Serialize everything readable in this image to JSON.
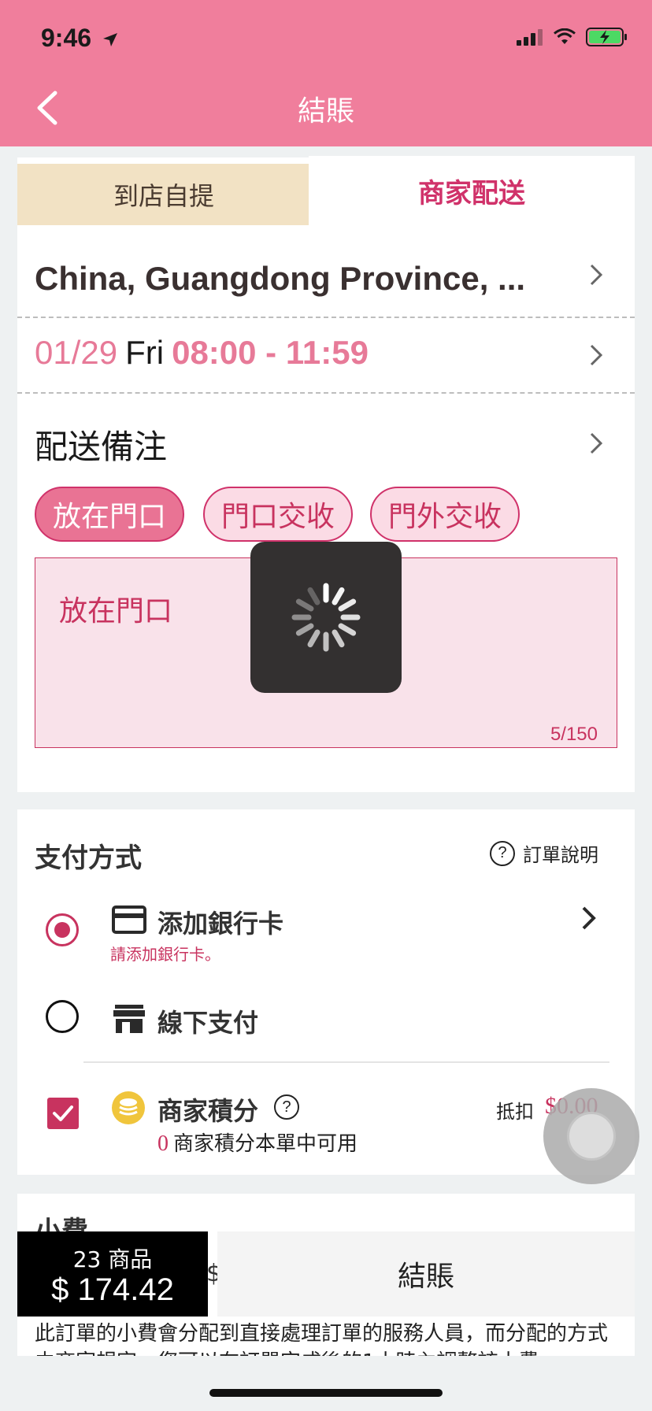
{
  "status_bar": {
    "time": "9:46"
  },
  "header": {
    "title": "結賬"
  },
  "tabs": {
    "pickup": "到店自提",
    "delivery": "商家配送"
  },
  "delivery": {
    "address": "China, Guangdong Province, ...",
    "date": "01/29",
    "day": "Fri",
    "time_range": "08:00 - 11:59"
  },
  "note": {
    "title": "配送備注",
    "chips": [
      "放在門口",
      "門口交收",
      "門外交收"
    ],
    "text": "放在門口",
    "count": "5/150"
  },
  "payment": {
    "title": "支付方式",
    "order_help": "訂單說明",
    "add_card_label": "添加銀行卡",
    "add_card_sub": "請添加銀行卡。",
    "offline_label": "線下支付",
    "points_label": "商家積分",
    "points_value": "0",
    "points_sub": "商家積分本單中可用",
    "deduct_label": "抵扣",
    "deduct_amount": "$0.00"
  },
  "tip": {
    "title": "小費",
    "currency": "$",
    "description": "此訂單的小費會分配到直接處理訂單的服務人員，而分配的方式由商家規定。您可以在訂單完成後的1小時內調整該小費"
  },
  "cart": {
    "count": "23 商品",
    "total": "$ 174.42"
  },
  "checkout": {
    "label": "結賬"
  },
  "colors": {
    "header": "#f07e9c",
    "accent": "#c8335f",
    "pink_text": "#e77a98",
    "pickup_tab": "#f2e2c4"
  }
}
